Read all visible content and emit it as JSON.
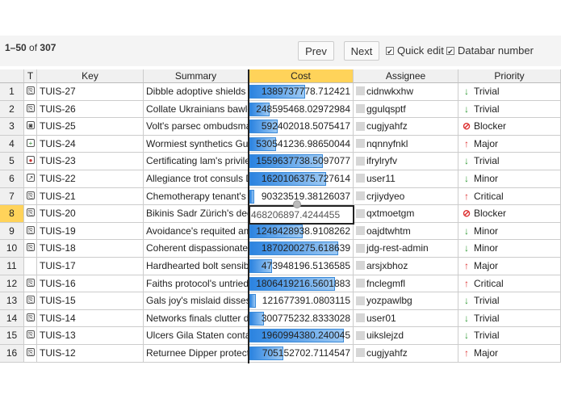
{
  "pager": {
    "range": "1–50",
    "of": "of",
    "total": "307",
    "prev": "Prev",
    "next": "Next"
  },
  "options": {
    "quick_edit": "Quick edit",
    "databar": "Databar number"
  },
  "columns": [
    "",
    "T",
    "Key",
    "Summary",
    "Cost",
    "Assignee",
    "Priority"
  ],
  "rows": [
    {
      "n": "1",
      "type": "paperclip-icon",
      "key": "TUIS-27",
      "summary": "Dibble adoptive shields p",
      "cost": "1389737778.712421",
      "cost_frac": 0.55,
      "assignee": "cidnwkxhw",
      "priority": "Trivial"
    },
    {
      "n": "2",
      "type": "paperclip-icon",
      "key": "TUIS-26",
      "summary": "Collate Ukrainians bawle",
      "cost": "248595468.02972984",
      "cost_frac": 0.2,
      "assignee": "ggulqsptf",
      "priority": "Trivial"
    },
    {
      "n": "3",
      "type": "block-square-icon",
      "key": "TUIS-25",
      "summary": "Volt's parsec ombudsmar",
      "cost": "592402018.5075417",
      "cost_frac": 0.28,
      "assignee": "cugjyahfz",
      "priority": "Blocker"
    },
    {
      "n": "4",
      "type": "plus-square-icon",
      "key": "TUIS-24",
      "summary": "Wormiest synthetics Gus",
      "cost": "530541236.98650044",
      "cost_frac": 0.26,
      "assignee": "nqnnyfnkl",
      "priority": "Major"
    },
    {
      "n": "5",
      "type": "bug-icon",
      "key": "TUIS-23",
      "summary": "Certificating lam's privileg",
      "cost": "1559637738.5097077",
      "cost_frac": 0.72,
      "assignee": "ifrylryfv",
      "priority": "Trivial"
    },
    {
      "n": "6",
      "type": "arrow-square-icon",
      "key": "TUIS-22",
      "summary": "Allegiance trot consuls Do",
      "cost": "1620106375.727614",
      "cost_frac": 0.75,
      "assignee": "user11",
      "priority": "Minor"
    },
    {
      "n": "7",
      "type": "paperclip-icon",
      "key": "TUIS-21",
      "summary": "Chemotherapy tenant's pl",
      "cost": "90323519.38126037",
      "cost_frac": 0.05,
      "assignee": "crjiydyeo",
      "priority": "Critical"
    },
    {
      "n": "8",
      "type": "paperclip-icon",
      "key": "TUIS-20",
      "summary": "Bikinis Sadr Zürich's dece",
      "cost": "",
      "cost_frac": 0,
      "assignee": "qxtmoetgm",
      "priority": "Blocker"
    },
    {
      "n": "9",
      "type": "paperclip-icon",
      "key": "TUIS-19",
      "summary": "Avoidance's requited amp",
      "cost": "1248428938.9108262",
      "cost_frac": 0.52,
      "assignee": "oajdtwhtm",
      "priority": "Minor"
    },
    {
      "n": "10",
      "type": "paperclip-icon",
      "key": "TUIS-18",
      "summary": "Coherent dispassionately",
      "cost": "1870200275.618639",
      "cost_frac": 0.87,
      "assignee": "jdg-rest-admin",
      "priority": "Minor"
    },
    {
      "n": "11",
      "type": "",
      "key": "TUIS-17",
      "summary": "Hardhearted bolt sensibili",
      "cost": "473948196.5136585",
      "cost_frac": 0.22,
      "assignee": "arsjxbhoz",
      "priority": "Major"
    },
    {
      "n": "12",
      "type": "paperclip-icon",
      "key": "TUIS-16",
      "summary": "Faiths protocol's untried c",
      "cost": "1806419216.5601883",
      "cost_frac": 0.84,
      "assignee": "fnclegmfl",
      "priority": "Critical"
    },
    {
      "n": "13",
      "type": "paperclip-icon",
      "key": "TUIS-15",
      "summary": "Gals joy's mislaid disses",
      "cost": "121677391.0803115",
      "cost_frac": 0.06,
      "assignee": "yozpawlbg",
      "priority": "Trivial"
    },
    {
      "n": "14",
      "type": "paperclip-icon",
      "key": "TUIS-14",
      "summary": "Networks finals clutter de",
      "cost": "300775232.8333028",
      "cost_frac": 0.14,
      "assignee": "user01",
      "priority": "Trivial"
    },
    {
      "n": "15",
      "type": "paperclip-icon",
      "key": "TUIS-13",
      "summary": "Ulcers Gila Staten contac",
      "cost": "1960994380.240045",
      "cost_frac": 0.93,
      "assignee": "uikslejzd",
      "priority": "Trivial"
    },
    {
      "n": "16",
      "type": "paperclip-icon",
      "key": "TUIS-12",
      "summary": "Returnee Dipper protectio",
      "cost": "705152702.7114547",
      "cost_frac": 0.33,
      "assignee": "cugjyahfz",
      "priority": "Major"
    }
  ],
  "editor": {
    "value": "468206897.4244455"
  },
  "priority_styles": {
    "Trivial": {
      "glyph": "↓",
      "color": "#2e9a35"
    },
    "Minor": {
      "glyph": "↓",
      "color": "#2e9a35"
    },
    "Major": {
      "glyph": "↑",
      "color": "#d33"
    },
    "Critical": {
      "glyph": "↑",
      "color": "#d33"
    },
    "Blocker": {
      "glyph": "⊘",
      "color": "#d33"
    }
  },
  "active_row": "8"
}
